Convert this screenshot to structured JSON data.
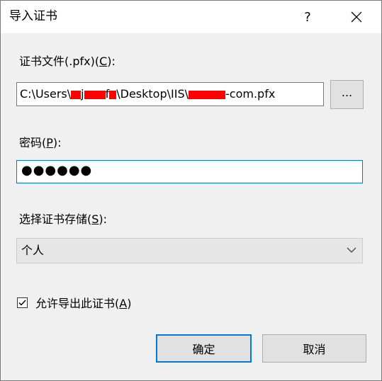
{
  "window": {
    "title": "导入证书",
    "help_label": "?"
  },
  "file": {
    "label_text": "证书文件(.pfx)(",
    "label_key": "C",
    "label_end": "):",
    "path_part1": "C:\\Users\\",
    "path_part2": "j",
    "path_part3": "f",
    "path_part4": "\\Desktop\\IIS\\",
    "path_part5": "-com.pfx",
    "browse_label": "..."
  },
  "password": {
    "label_text": "密码(",
    "label_key": "P",
    "label_end": "):",
    "value": "●●●●●●"
  },
  "store": {
    "label_text": "选择证书存储(",
    "label_key": "S",
    "label_end": "):",
    "selected": "个人"
  },
  "export": {
    "label_text": "允许导出此证书(",
    "label_key": "A",
    "label_end": ")",
    "checked": true
  },
  "buttons": {
    "ok": "确定",
    "cancel": "取消"
  },
  "colors": {
    "accent": "#0078d7",
    "redaction": "#ff0000",
    "dialog_bg": "#f0f0f0"
  }
}
